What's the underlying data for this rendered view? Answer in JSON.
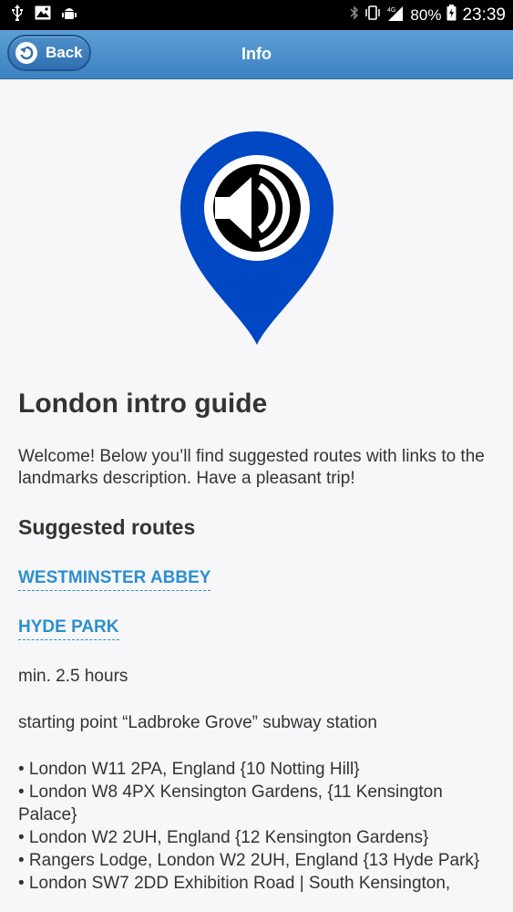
{
  "status_bar": {
    "battery_percent": "80%",
    "time": "23:39",
    "network": "4G"
  },
  "header": {
    "back_label": "Back",
    "title": "Info"
  },
  "guide": {
    "title": "London intro guide",
    "intro": "Welcome! Below you’ll find suggested routes with links to the landmarks description. Have a pleasant trip!",
    "suggested_routes_heading": "Suggested routes",
    "routes": [
      {
        "label": "WESTMINSTER ABBEY"
      },
      {
        "label": "HYDE PARK"
      }
    ],
    "duration": "min. 2.5 hours",
    "starting_point": "starting point “Ladbroke Grove” subway station",
    "addresses": [
      "• London W11 2PA, England {10 Notting Hill}",
      "• London W8 4PX Kensington Gardens, {11 Kensington Palace}",
      "• London W2 2UH, England {12 Kensington Gardens}",
      "• Rangers Lodge, London W2 2UH, England {13 Hyde Park}",
      "• London SW7 2DD Exhibition Road | South Kensington,"
    ]
  },
  "colors": {
    "header": "#4a8fcd",
    "pin": "#0047c4",
    "link": "#2b8fd0",
    "text": "#333333"
  },
  "icons": {
    "pin": "audio-guide-pin-icon",
    "back": "back-arrow-icon"
  }
}
